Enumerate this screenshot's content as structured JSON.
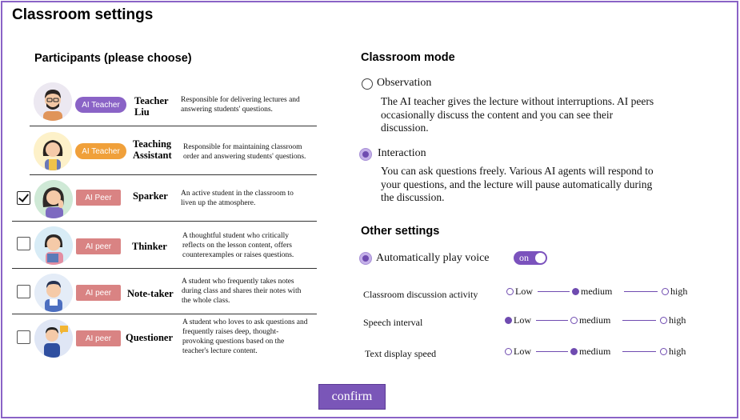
{
  "page": {
    "title": "Classroom settings"
  },
  "participants": {
    "heading": "Participants   (please choose)",
    "items": [
      {
        "badge": "AI Teacher",
        "name": "Teacher Liu",
        "desc": "Responsible for delivering lectures and answering students' questions.",
        "checked": null
      },
      {
        "badge": "AI Teacher",
        "name": "Teaching Assistant",
        "desc": "Responsible for maintaining classroom order and answering students' questions.",
        "checked": null
      },
      {
        "badge": "AI Peer",
        "name": "Sparker",
        "desc": "An active student in the classroom to liven up the atmosphere.",
        "checked": true
      },
      {
        "badge": "AI peer",
        "name": "Thinker",
        "desc": "A thoughtful student who critically reflects on the lesson content, offers counterexamples or raises questions.",
        "checked": false
      },
      {
        "badge": "AI peer",
        "name": "Note-taker",
        "desc": "A student who frequently takes notes during class and shares their notes with the whole class.",
        "checked": false
      },
      {
        "badge": "AI peer",
        "name": "Questioner",
        "desc": "A student who loves to ask questions and frequently raises deep, thought-provoking questions based on the teacher's lecture content.",
        "checked": false
      }
    ]
  },
  "classroom_mode": {
    "heading": "Classroom mode",
    "options": [
      {
        "label": "Observation",
        "desc": "The AI teacher gives the lecture without interruptions. AI peers occasionally discuss the content and you can see their discussion.",
        "selected": false
      },
      {
        "label": "Interaction",
        "desc": "You can ask questions freely. Various AI agents will respond to your questions, and the lecture will pause automatically during the discussion.",
        "selected": true
      }
    ]
  },
  "other_settings": {
    "heading": "Other settings",
    "autoplay": {
      "label": "Automatically play voice",
      "toggle_text": "on",
      "value": true
    },
    "levels": [
      {
        "label": "Classroom discussion activity",
        "options": [
          "Low",
          "medium",
          "high"
        ],
        "selected": "medium"
      },
      {
        "label": "Speech interval",
        "options": [
          "Low",
          "medium",
          "high"
        ],
        "selected": "Low"
      },
      {
        "label": "Text display speed",
        "options": [
          "Low",
          "medium",
          "high"
        ],
        "selected": "medium"
      }
    ]
  },
  "confirm_label": "confirm",
  "colors": {
    "accent": "#7a56b8",
    "badge_teacher_purple": "#8a63c6",
    "badge_teacher_orange": "#f0a03a",
    "badge_peer": "#d98383",
    "frame": "#8a63c6"
  }
}
